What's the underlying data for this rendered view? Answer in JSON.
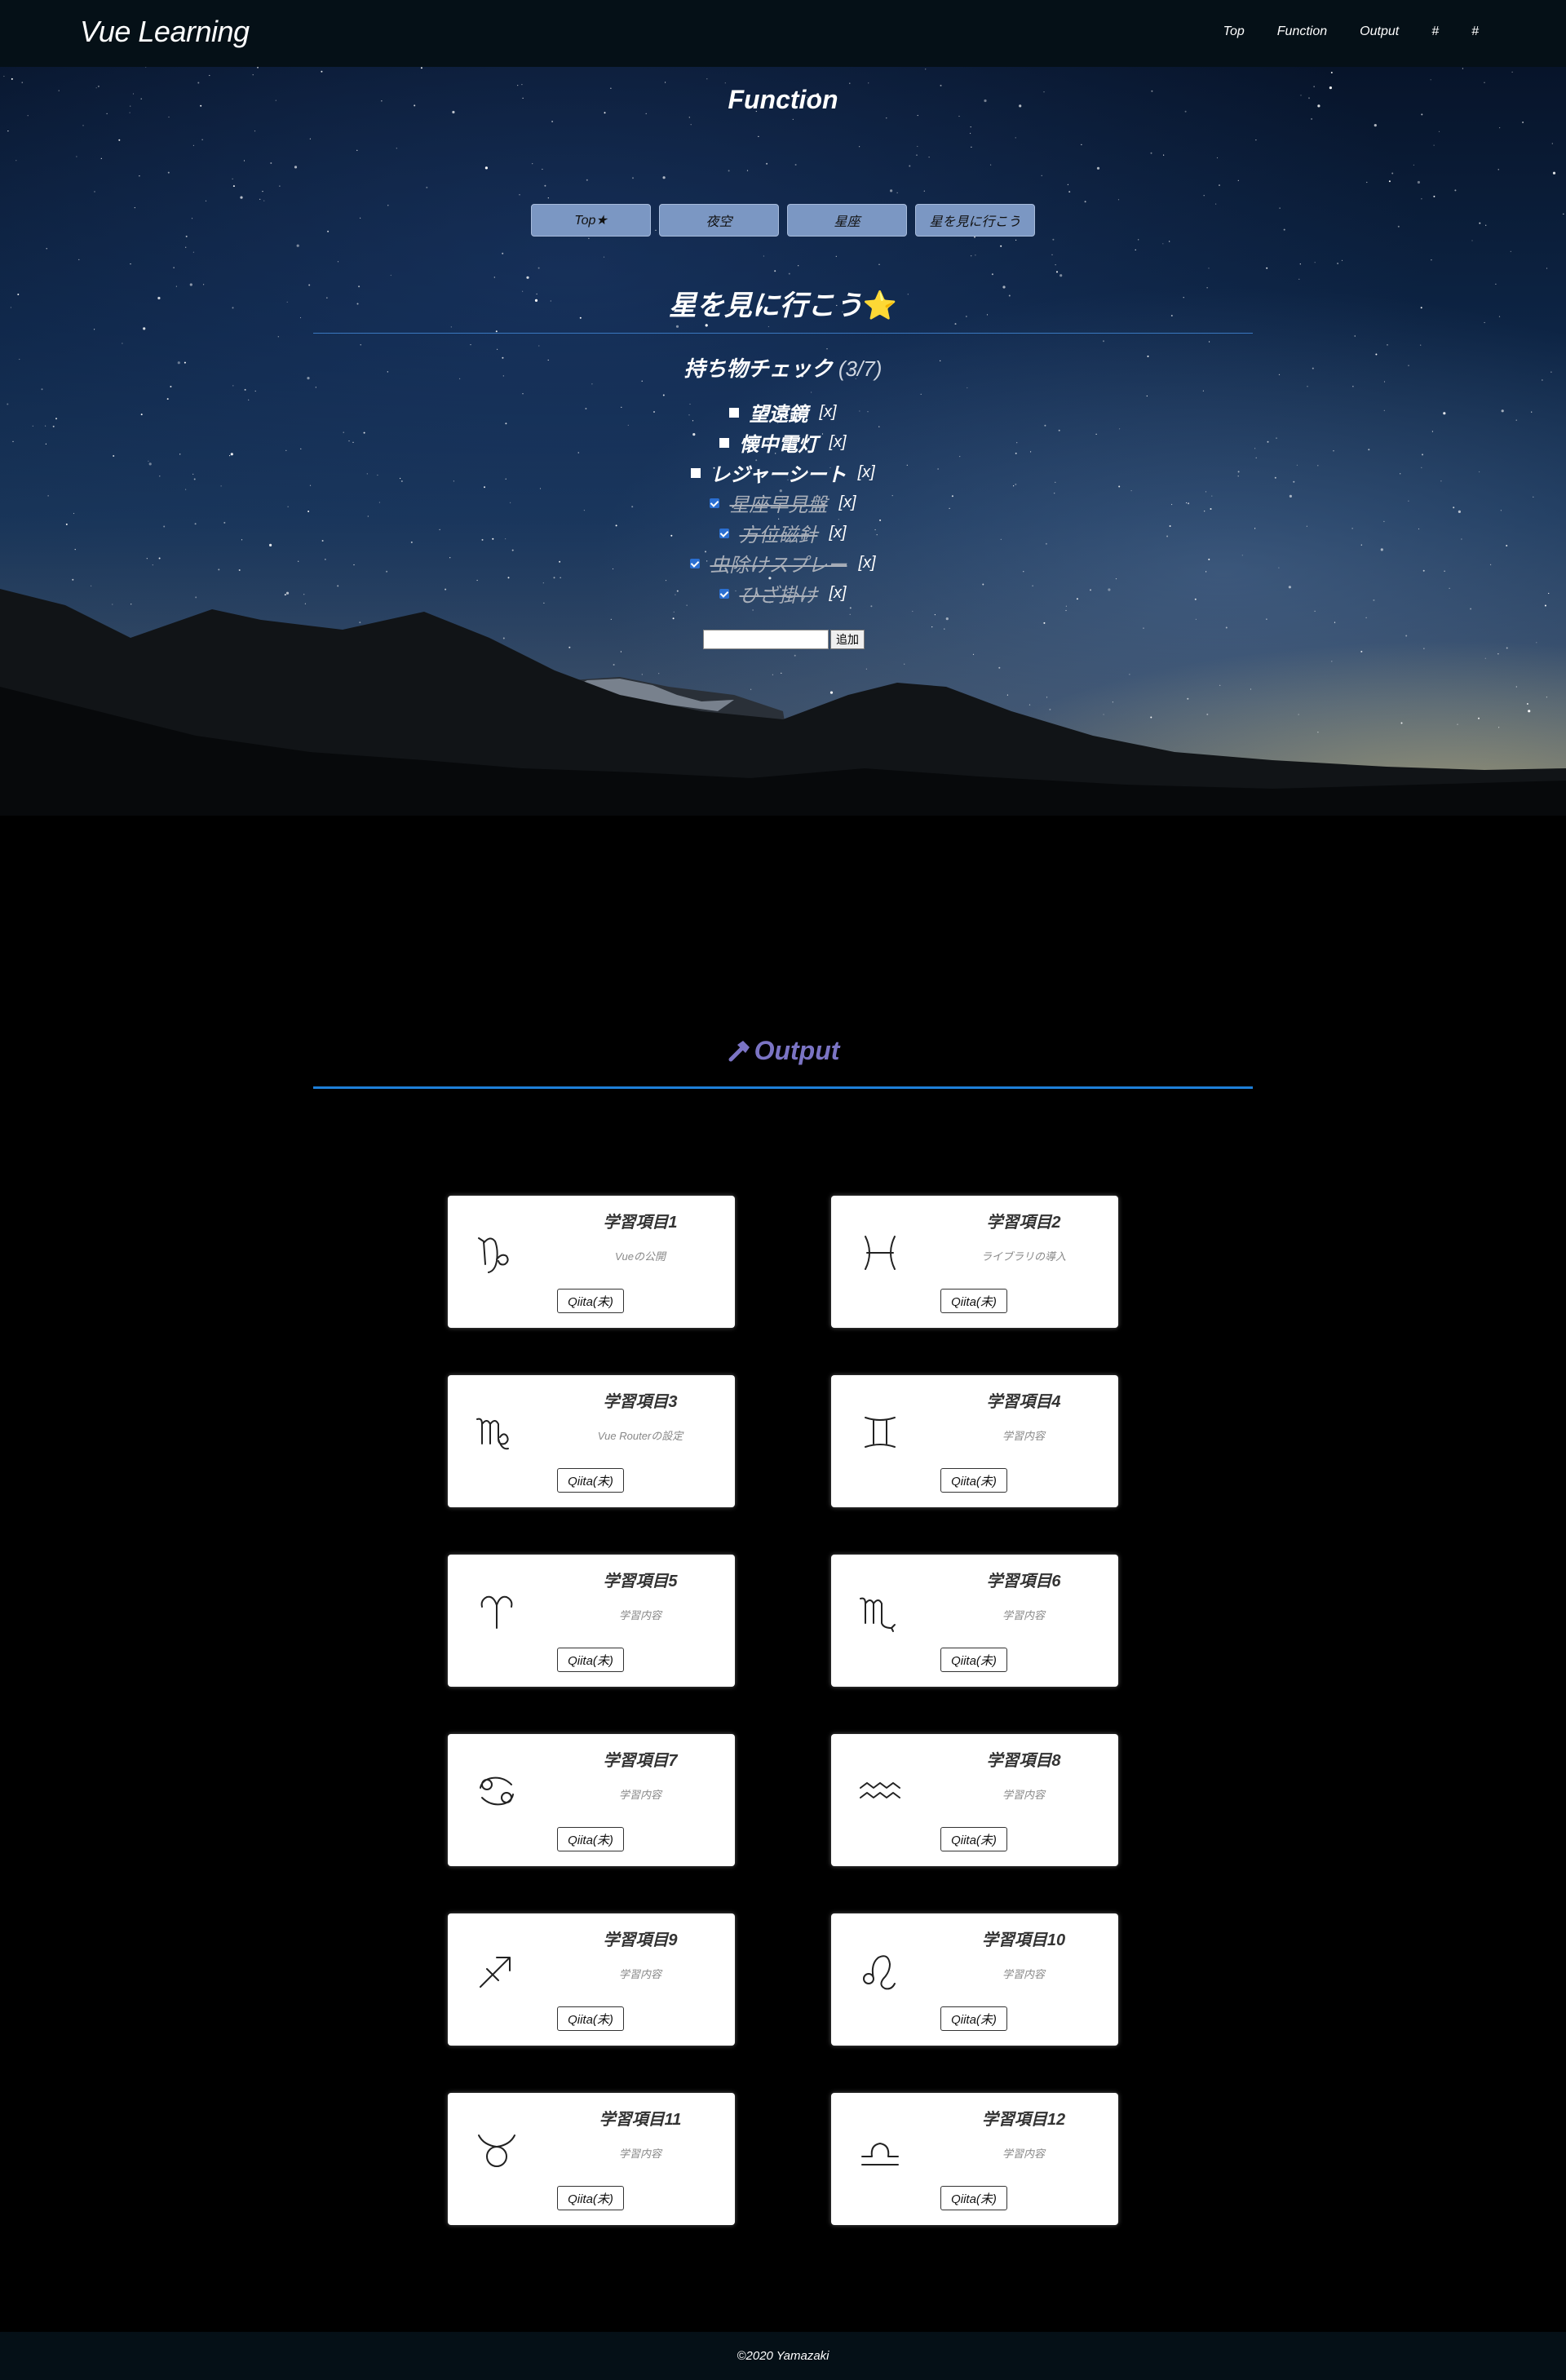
{
  "header": {
    "brand": "Vue Learning",
    "nav": [
      "Top",
      "Function",
      "Output",
      "#",
      "#"
    ]
  },
  "function_section": {
    "title": "Function",
    "tabs": [
      "Top★",
      "夜空",
      "星座",
      "星を見に行こう"
    ],
    "subtitle": "星を見に行こう",
    "subtitle_emoji": "⭐",
    "checklist_title": "持ち物チェック",
    "checklist_count": "(3/7)",
    "items": [
      {
        "label": "望遠鏡",
        "checked": false,
        "remove": "[x]"
      },
      {
        "label": "懐中電灯",
        "checked": false,
        "remove": "[x]"
      },
      {
        "label": "レジャーシート",
        "checked": false,
        "remove": "[x]"
      },
      {
        "label": "星座早見盤",
        "checked": true,
        "remove": "[x]"
      },
      {
        "label": "方位磁針",
        "checked": true,
        "remove": "[x]"
      },
      {
        "label": "虫除けスプレー",
        "checked": true,
        "remove": "[x]"
      },
      {
        "label": "ひざ掛け",
        "checked": true,
        "remove": "[x]"
      }
    ],
    "add_input_value": "",
    "add_button": "追加"
  },
  "output_section": {
    "title": "Output",
    "title_icon": "hammer-icon",
    "title_color": "#7b74c4",
    "cards": [
      {
        "title": "学習項目1",
        "desc": "Vueの公開",
        "button": "Qiita(未)",
        "icon": "capricorn-icon"
      },
      {
        "title": "学習項目2",
        "desc": "ライブラリの導入",
        "button": "Qiita(未)",
        "icon": "pisces-icon"
      },
      {
        "title": "学習項目3",
        "desc": "Vue Routerの設定",
        "button": "Qiita(未)",
        "icon": "virgo-icon"
      },
      {
        "title": "学習項目4",
        "desc": "学習内容",
        "button": "Qiita(未)",
        "icon": "gemini-icon"
      },
      {
        "title": "学習項目5",
        "desc": "学習内容",
        "button": "Qiita(未)",
        "icon": "aries-icon"
      },
      {
        "title": "学習項目6",
        "desc": "学習内容",
        "button": "Qiita(未)",
        "icon": "scorpio-icon"
      },
      {
        "title": "学習項目7",
        "desc": "学習内容",
        "button": "Qiita(未)",
        "icon": "cancer-icon"
      },
      {
        "title": "学習項目8",
        "desc": "学習内容",
        "button": "Qiita(未)",
        "icon": "aquarius-icon"
      },
      {
        "title": "学習項目9",
        "desc": "学習内容",
        "button": "Qiita(未)",
        "icon": "sagittarius-icon"
      },
      {
        "title": "学習項目10",
        "desc": "学習内容",
        "button": "Qiita(未)",
        "icon": "leo-icon"
      },
      {
        "title": "学習項目11",
        "desc": "学習内容",
        "button": "Qiita(未)",
        "icon": "taurus-icon"
      },
      {
        "title": "学習項目12",
        "desc": "学習内容",
        "button": "Qiita(未)",
        "icon": "libra-icon"
      }
    ]
  },
  "footer": {
    "copyright": "©2020 Yamazaki"
  }
}
